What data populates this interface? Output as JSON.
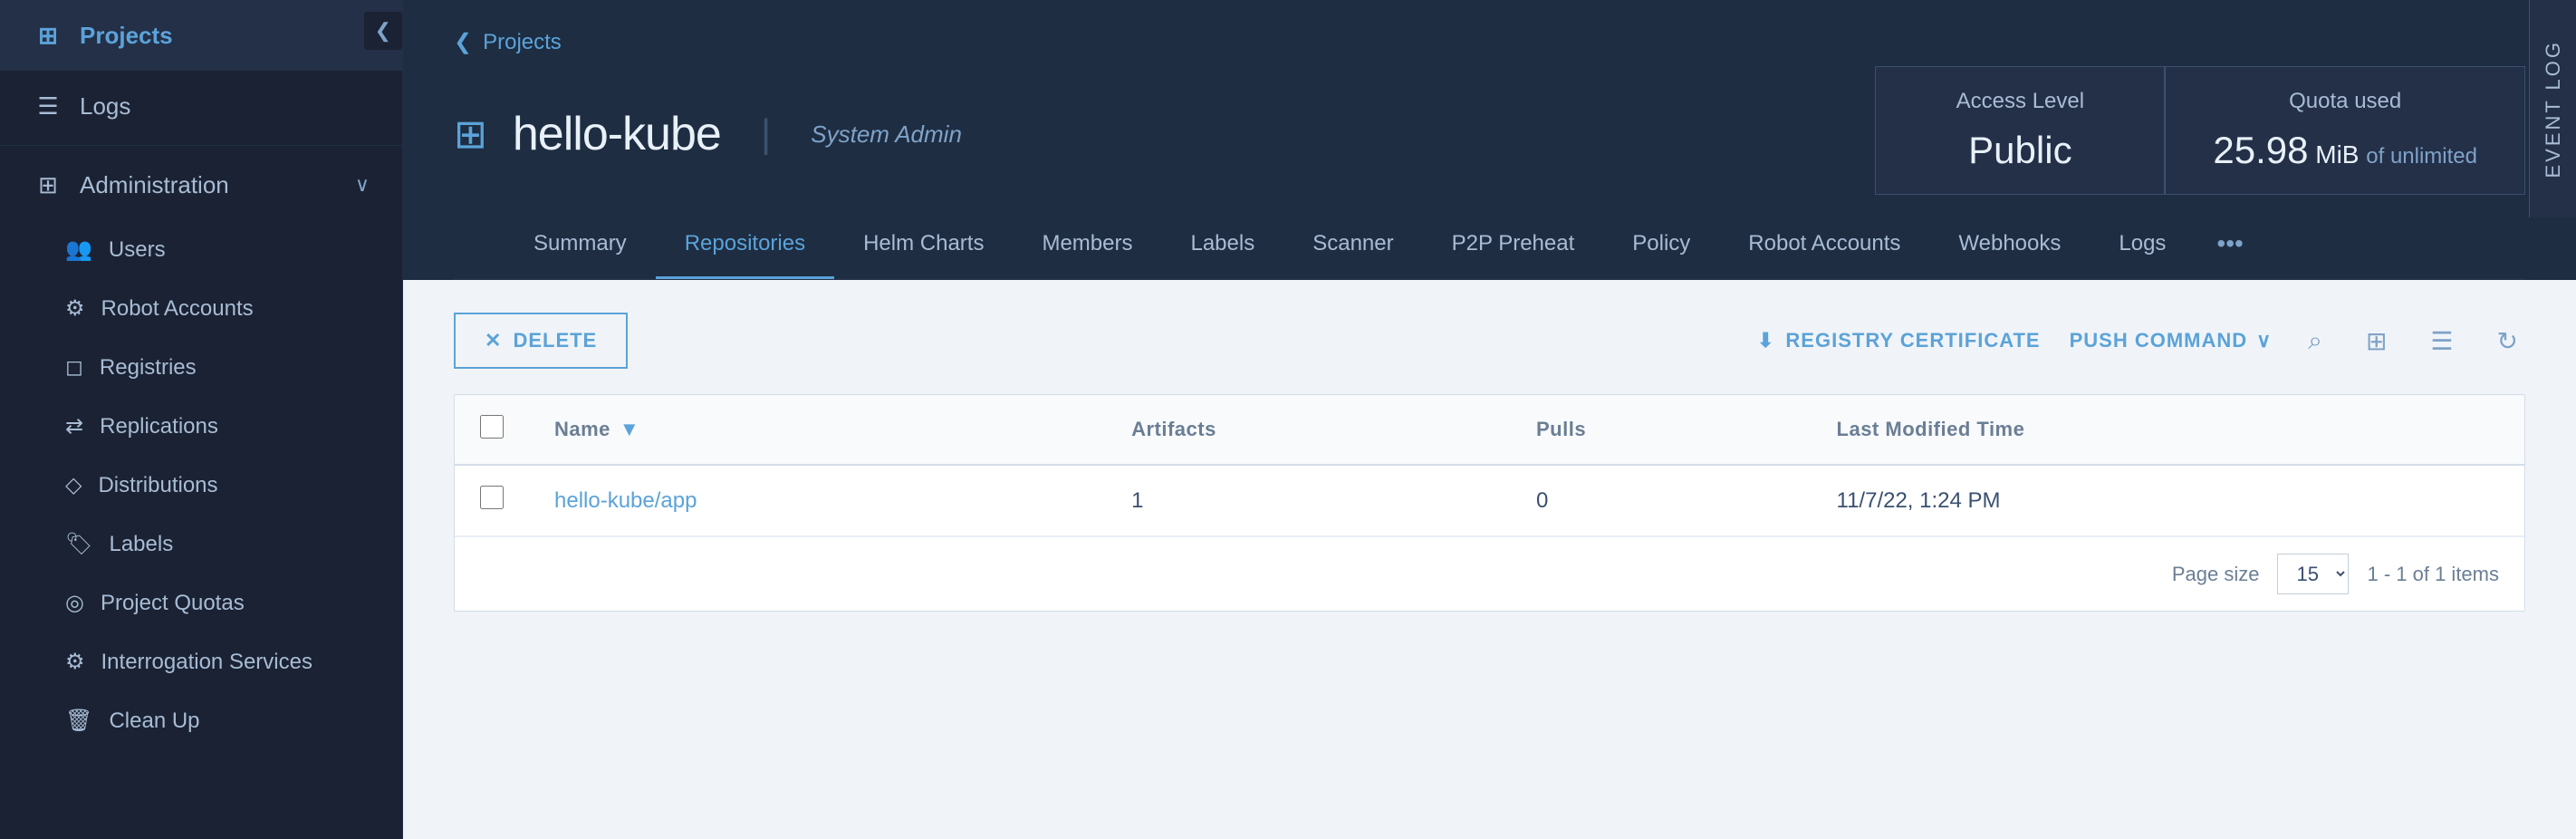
{
  "sidebar": {
    "collapse_label": "❮",
    "items": [
      {
        "id": "projects",
        "label": "Projects",
        "icon": "⊞",
        "active": true
      },
      {
        "id": "logs",
        "label": "Logs",
        "icon": "☰",
        "active": false
      }
    ],
    "admin_section": {
      "label": "Administration",
      "icon": "⊞",
      "chevron": "∨",
      "sub_items": [
        {
          "id": "users",
          "label": "Users",
          "icon": "👥"
        },
        {
          "id": "robot-accounts",
          "label": "Robot Accounts",
          "icon": "⚙",
          "active": true
        },
        {
          "id": "registries",
          "label": "Registries",
          "icon": "◻"
        },
        {
          "id": "replications",
          "label": "Replications",
          "icon": "⇄"
        },
        {
          "id": "distributions",
          "label": "Distributions",
          "icon": "◇"
        },
        {
          "id": "labels",
          "label": "Labels",
          "icon": "🏷"
        },
        {
          "id": "project-quotas",
          "label": "Project Quotas",
          "icon": "◎"
        },
        {
          "id": "interrogation",
          "label": "Interrogation Services",
          "icon": "⚙"
        },
        {
          "id": "cleanup",
          "label": "Clean Up",
          "icon": "🗑"
        }
      ]
    }
  },
  "event_log_tab": {
    "label": "EVENT LOG"
  },
  "header": {
    "breadcrumb_arrow": "❮",
    "breadcrumb_label": "Projects",
    "project_icon": "⊞",
    "project_name": "hello-kube",
    "project_separator": "|",
    "project_role": "System Admin",
    "access_card": {
      "label": "Access Level",
      "value": "Public"
    },
    "quota_card": {
      "label": "Quota used",
      "value": "25.98",
      "unit": "MiB",
      "limit_label": "of unlimited"
    }
  },
  "tabs": [
    {
      "id": "summary",
      "label": "Summary",
      "active": false
    },
    {
      "id": "repositories",
      "label": "Repositories",
      "active": true
    },
    {
      "id": "helm-charts",
      "label": "Helm Charts",
      "active": false
    },
    {
      "id": "members",
      "label": "Members",
      "active": false
    },
    {
      "id": "labels",
      "label": "Labels",
      "active": false
    },
    {
      "id": "scanner",
      "label": "Scanner",
      "active": false
    },
    {
      "id": "p2p-preheat",
      "label": "P2P Preheat",
      "active": false
    },
    {
      "id": "policy",
      "label": "Policy",
      "active": false
    },
    {
      "id": "robot-accounts",
      "label": "Robot Accounts",
      "active": false
    },
    {
      "id": "webhooks",
      "label": "Webhooks",
      "active": false
    },
    {
      "id": "logs",
      "label": "Logs",
      "active": false
    }
  ],
  "tabs_more": "•••",
  "toolbar": {
    "delete_label": "DELETE",
    "delete_icon": "✕",
    "registry_cert_label": "REGISTRY CERTIFICATE",
    "registry_cert_icon": "⬇",
    "push_command_label": "PUSH COMMAND",
    "push_command_chevron": "∨",
    "search_icon": "⌕",
    "view_grid_icon": "⊞",
    "view_list_icon": "☰",
    "refresh_icon": "↻"
  },
  "table": {
    "columns": [
      {
        "id": "checkbox",
        "label": ""
      },
      {
        "id": "name",
        "label": "Name"
      },
      {
        "id": "artifacts",
        "label": "Artifacts"
      },
      {
        "id": "pulls",
        "label": "Pulls"
      },
      {
        "id": "last-modified",
        "label": "Last Modified Time"
      }
    ],
    "rows": [
      {
        "name": "hello-kube/app",
        "artifacts": "1",
        "pulls": "0",
        "last_modified": "11/7/22, 1:24 PM"
      }
    ]
  },
  "pagination": {
    "page_size_label": "Page size",
    "page_size": "15",
    "page_info": "1 - 1 of 1 items"
  }
}
